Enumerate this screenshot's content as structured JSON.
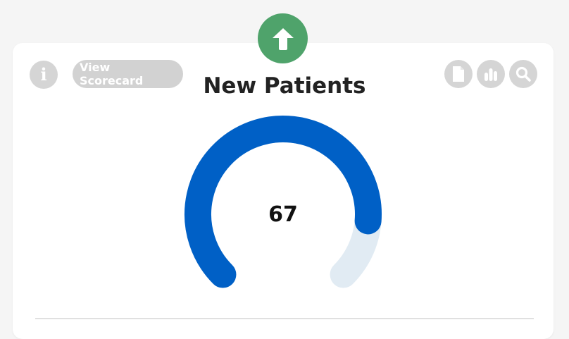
{
  "card": {
    "title": "New Patients",
    "view_scorecard_label": "View Scorecard"
  },
  "icons": {
    "trend": "arrow-up-icon",
    "info": "info-icon",
    "document": "document-icon",
    "bar_chart": "bar-chart-icon",
    "search": "search-icon"
  },
  "gauge": {
    "value_label": "67",
    "progress_fraction": 0.85
  },
  "colors": {
    "trend_up": "#4fa36b",
    "gauge_fill": "#0060c6",
    "gauge_track": "#e1ebf3",
    "button_grey": "#d5d5d5"
  }
}
